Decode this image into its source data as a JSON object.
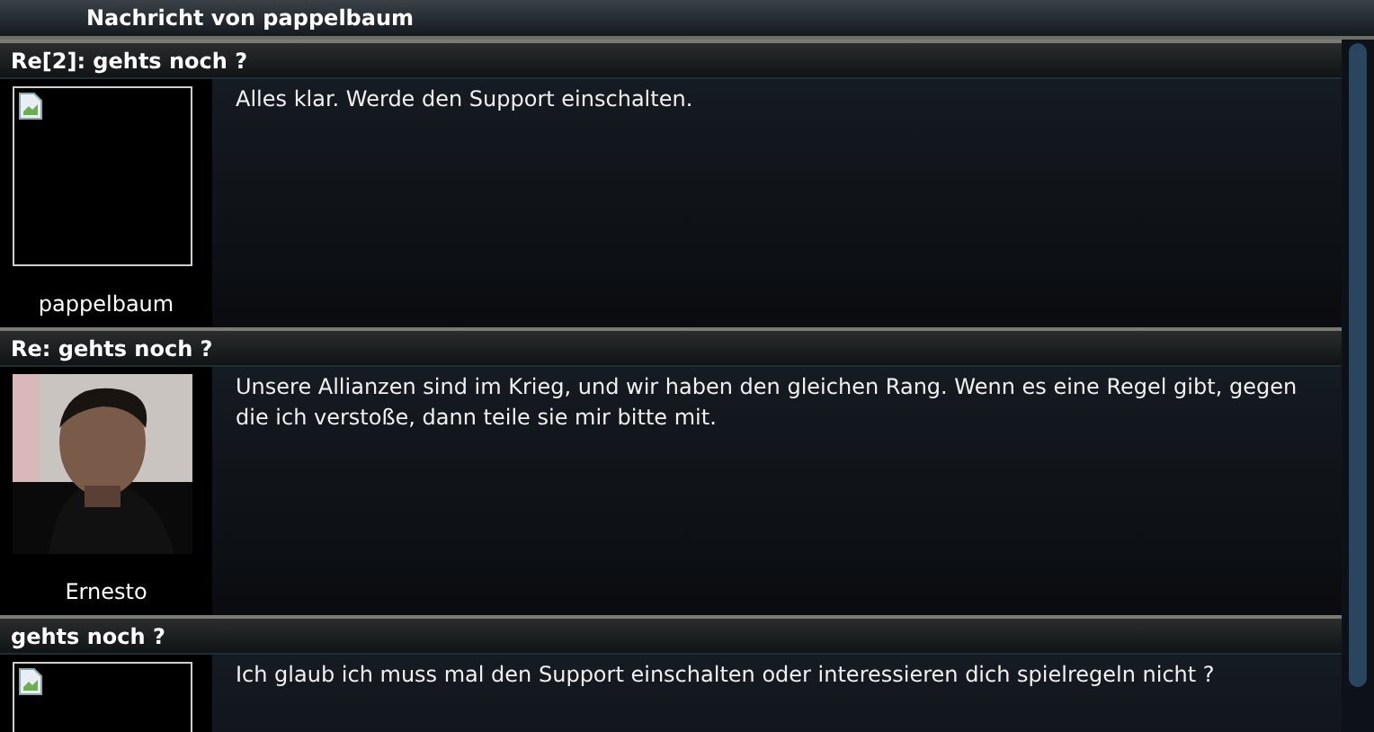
{
  "window": {
    "title": "Nachricht von pappelbaum"
  },
  "messages": [
    {
      "subject": "Re[2]: gehts noch ?",
      "avatar": {
        "kind": "broken"
      },
      "author": "pappelbaum",
      "text": "Alles klar. Werde den Support einschalten."
    },
    {
      "subject": "Re: gehts noch ?",
      "author": "Ernesto",
      "text": "Unsere Allianzen sind im Krieg, und wir haben den gleichen Rang. Wenn es eine Regel gibt, gegen die ich verstoße, dann teile sie mir bitte mit."
    },
    {
      "subject": "gehts noch ?",
      "avatar": {
        "kind": "broken"
      },
      "text": "Ich glaub ich muss mal den Support einschalten oder interessieren dich spielregeln nicht ?"
    }
  ]
}
